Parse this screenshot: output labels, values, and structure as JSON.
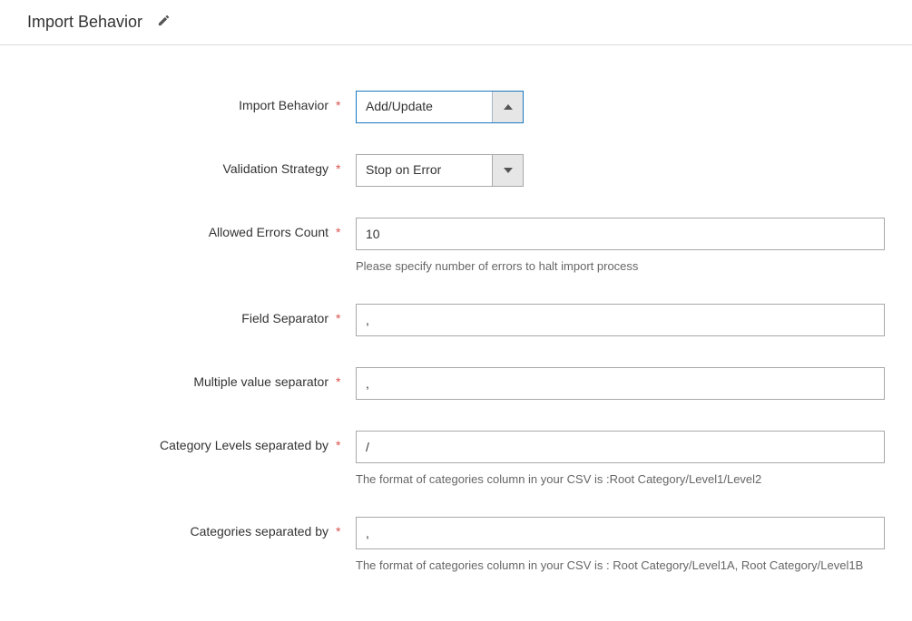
{
  "section_title": "Import Behavior",
  "fields": {
    "import_behavior": {
      "label": "Import Behavior",
      "value": "Add/Update"
    },
    "validation_strategy": {
      "label": "Validation Strategy",
      "value": "Stop on Error"
    },
    "allowed_errors": {
      "label": "Allowed Errors Count",
      "value": "10",
      "help": "Please specify number of errors to halt import process"
    },
    "field_separator": {
      "label": "Field Separator",
      "value": ","
    },
    "multi_value_separator": {
      "label": "Multiple value separator",
      "value": ","
    },
    "category_levels_sep": {
      "label": "Category Levels separated by",
      "value": "/",
      "help": "The format of categories column in your CSV is :Root Category/Level1/Level2"
    },
    "categories_sep": {
      "label": "Categories separated by",
      "value": ",",
      "help": "The format of categories column in your CSV is : Root Category/Level1A, Root Category/Level1B"
    }
  }
}
